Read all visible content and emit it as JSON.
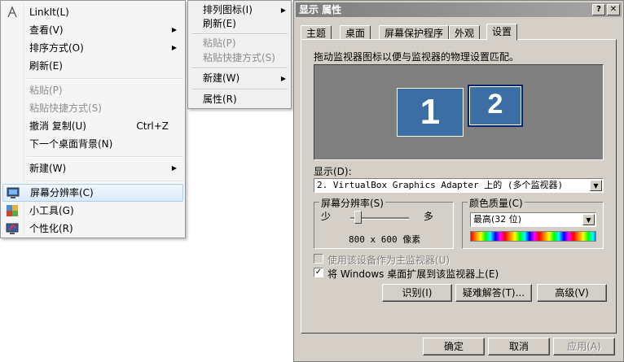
{
  "context_menu": {
    "items": [
      {
        "label": "LinkIt(L)",
        "icon": "linkit-icon"
      },
      {
        "label": "查看(V)",
        "submenu": true
      },
      {
        "label": "排序方式(O)",
        "submenu": true
      },
      {
        "label": "刷新(E)"
      },
      {
        "label": "粘贴(P)",
        "disabled": true
      },
      {
        "label": "粘贴快捷方式(S)",
        "disabled": true
      },
      {
        "label": "撤消 复制(U)",
        "accel": "Ctrl+Z"
      },
      {
        "label": "下一个桌面背景(N)"
      },
      {
        "label": "新建(W)",
        "submenu": true
      },
      {
        "label": "屏幕分辨率(C)",
        "icon": "display-icon",
        "highlighted": true
      },
      {
        "label": "小工具(G)",
        "icon": "gadgets-icon"
      },
      {
        "label": "个性化(R)",
        "icon": "personalize-icon"
      }
    ]
  },
  "submenu": {
    "items": [
      {
        "label": "排列图标(I)",
        "submenu": true
      },
      {
        "label": "刷新(E)"
      },
      {
        "label": "粘贴(P)",
        "disabled": true
      },
      {
        "label": "粘贴快捷方式(S)",
        "disabled": true
      },
      {
        "label": "新建(W)",
        "submenu": true
      },
      {
        "label": "属性(R)"
      }
    ]
  },
  "dialog": {
    "title": "显示 属性",
    "help_button": "?",
    "close_button": "✕",
    "tabs": [
      "主题",
      "桌面",
      "屏幕保护程序",
      "外观",
      "设置"
    ],
    "active_tab": "设置",
    "instruction": "拖动监视器图标以便与监视器的物理设置匹配。",
    "monitors": [
      "1",
      "2"
    ],
    "display_label": "显示(D):",
    "display_value": "2. VirtualBox Graphics Adapter 上的 (多个监视器)",
    "resolution": {
      "group_label": "屏幕分辨率(S)",
      "min_label": "少",
      "max_label": "多",
      "value": "800 x 600 像素"
    },
    "color": {
      "group_label": "颜色质量(C)",
      "value": "最高(32 位)"
    },
    "primary_checkbox": {
      "label": "使用该设备作为主监视器(U)",
      "checked": false,
      "disabled": true
    },
    "extend_checkbox": {
      "label": "将 Windows 桌面扩展到该监视器上(E)",
      "checked": true
    },
    "buttons": {
      "identify": "识别(I)",
      "troubleshoot": "疑难解答(T)...",
      "advanced": "高级(V)"
    },
    "footer_buttons": {
      "ok": "确定",
      "cancel": "取消",
      "apply": "应用(A)"
    },
    "colors": {
      "titlebar": "#7e7e7e",
      "face": "#d4d0c8",
      "monitor": "#3a6ea5"
    }
  }
}
